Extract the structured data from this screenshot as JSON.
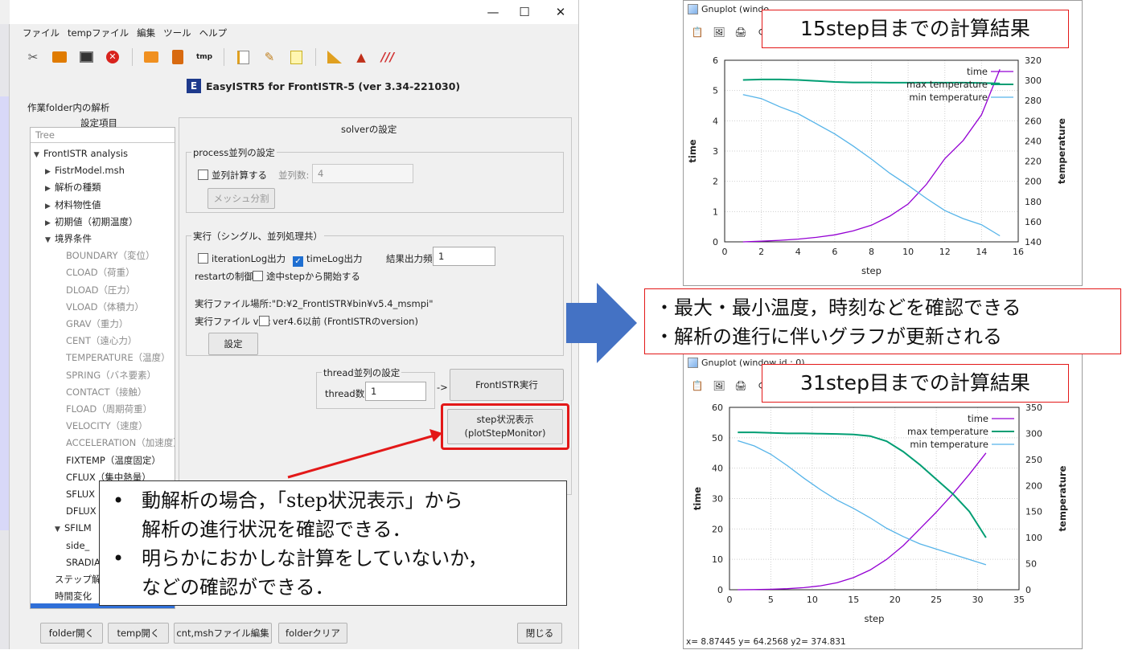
{
  "window": {
    "controls": {
      "minimize": "—",
      "maximize": "☐",
      "close": "✕"
    }
  },
  "menu": [
    "ファイル",
    "tempファイル",
    "編集",
    "ツール",
    "ヘルプ"
  ],
  "toolbar_icons": [
    "tools-icon",
    "folder-icon",
    "monitor-icon",
    "stop-icon",
    "open-folder-icon",
    "upload-icon",
    "tmp-icon",
    "edit-icon",
    "broom-icon",
    "note-icon",
    "ruler-icon",
    "shape-icon",
    "palette-icon"
  ],
  "app_title": "EasyISTR5 for FrontISTR-5  (ver 3.34-221030)",
  "app_logo": "E",
  "work_folder_label": "作業folder内の解析",
  "settings_header": "設定項目",
  "tree": {
    "header": "Tree",
    "items": [
      {
        "label": "FrontISTR analysis",
        "arrow": "▼"
      },
      {
        "label": "FistrModel.msh",
        "arrow": "▶"
      },
      {
        "label": "解析の種類",
        "arrow": "▶"
      },
      {
        "label": "材料物性値",
        "arrow": "▶"
      },
      {
        "label": "初期値（初期温度）",
        "arrow": "▶"
      },
      {
        "label": "境界条件",
        "arrow": "▼"
      },
      {
        "label": "BOUNDARY（変位）"
      },
      {
        "label": "CLOAD（荷重）"
      },
      {
        "label": "DLOAD（圧力）"
      },
      {
        "label": "VLOAD（体積力）"
      },
      {
        "label": "GRAV（重力）"
      },
      {
        "label": "CENT（遠心力）"
      },
      {
        "label": "TEMPERATURE（温度）"
      },
      {
        "label": "SPRING（バネ要素）"
      },
      {
        "label": "CONTACT（接触）"
      },
      {
        "label": "FLOAD（周期荷重）"
      },
      {
        "label": "VELOCITY（速度）"
      },
      {
        "label": "ACCELERATION（加速度）"
      },
      {
        "label": "FIXTEMP（温度固定）"
      },
      {
        "label": "CFLUX（集中熱量）"
      },
      {
        "label": "SFLUX"
      },
      {
        "label": "DFLUX"
      },
      {
        "label": "SFILM",
        "arrow": "▼"
      },
      {
        "label": "side_"
      },
      {
        "label": "SRADIA"
      },
      {
        "label": "ステップ解析"
      },
      {
        "label": "時間変化"
      }
    ]
  },
  "solver": {
    "title": "solverの設定",
    "process_group": "process並列の設定",
    "parallel_check": "並列計算する",
    "parallel_count_label": "並列数:",
    "parallel_count_value": "4",
    "mesh_split_button": "メッシュ分割",
    "exec_group": "実行（シングル、並列処理共）",
    "iteration_log": "iterationLog出力",
    "timelog": "timeLog出力",
    "output_freq_label": "結果出力頻度",
    "output_freq_value": "1",
    "restart_label": "restartの制御:",
    "restart_check": "途中stepから開始する",
    "exe_location": "実行ファイル場所:\"D:¥2_FrontISTR¥bin¥v5.4_msmpi\"",
    "exe_ver_label": "実行ファイル ver:",
    "exe_ver_check": "ver4.6以前 (FrontISTRのversion)",
    "settings_button": "設定",
    "thread_group": "thread並列の設定",
    "thread_label": "thread数:",
    "thread_value": "1",
    "arrow_text": "->",
    "run_button": "FrontISTR実行",
    "monitor_button_line1": "step状況表示",
    "monitor_button_line2": "(plotStepMonitor)"
  },
  "bottom_buttons": [
    "folder開く",
    "temp開く",
    "cnt,mshファイル編集",
    "folderクリア",
    "閉じる"
  ],
  "callout": {
    "bullet": "•",
    "lines": [
      "動解析の場合，「step状況表示」から",
      "解析の進行状況を確認できる．",
      "明らかにおかしな計算をしていないか，",
      "などの確認ができる．"
    ]
  },
  "gnuplot_top": {
    "title": "Gnuplot (windo",
    "label": "15step目までの計算結果"
  },
  "gnuplot_bottom": {
    "title": "Gnuplot (window id : 0)",
    "label": "31step目までの計算結果",
    "status": "x= 8.87445 y= 64.2568 y2= 374.831"
  },
  "note": {
    "lines": [
      "・最大・最小温度，時刻などを確認できる",
      "・解析の進行に伴いグラフが更新される"
    ]
  },
  "colors": {
    "time": "#9400d3",
    "max": "#009e73",
    "min": "#56b4e9",
    "red": "#e31818",
    "blue_arrow": "#4472c4"
  },
  "chart_data": [
    {
      "type": "line",
      "xlabel": "step",
      "ylabel": "time",
      "y2label": "temperature",
      "xlim": [
        0,
        16
      ],
      "ylim": [
        0,
        6
      ],
      "y2lim": [
        140,
        320
      ],
      "xticks": [
        0,
        2,
        4,
        6,
        8,
        10,
        12,
        14,
        16
      ],
      "yticks": [
        0,
        1,
        2,
        3,
        4,
        5,
        6
      ],
      "y2ticks": [
        140,
        160,
        180,
        200,
        220,
        240,
        260,
        280,
        300,
        320
      ],
      "grid": true,
      "legend": "top-right",
      "series": [
        {
          "name": "time",
          "axis": "y",
          "x": [
            1,
            2,
            3,
            4,
            5,
            6,
            7,
            8,
            9,
            10,
            11,
            12,
            13,
            14,
            15
          ],
          "values": [
            0.0,
            0.02,
            0.05,
            0.09,
            0.15,
            0.23,
            0.36,
            0.55,
            0.85,
            1.25,
            1.9,
            2.75,
            3.35,
            4.2,
            5.7
          ]
        },
        {
          "name": "max temperature",
          "axis": "y2",
          "x": [
            1,
            2,
            3,
            4,
            5,
            6,
            7,
            8,
            9,
            10,
            11,
            12,
            13,
            14,
            15
          ],
          "values": [
            300.5,
            301,
            301,
            300.5,
            299.5,
            298.5,
            298,
            298,
            297.8,
            297.8,
            297.8,
            297.8,
            297.8,
            297.5,
            297
          ]
        },
        {
          "name": "min temperature",
          "axis": "y2",
          "x": [
            1,
            2,
            3,
            4,
            5,
            6,
            7,
            8,
            9,
            10,
            11,
            12,
            13,
            14,
            15
          ],
          "values": [
            286,
            282,
            274,
            267,
            257,
            247,
            235,
            222,
            208,
            196,
            183,
            171,
            163,
            157,
            146
          ]
        }
      ]
    },
    {
      "type": "line",
      "xlabel": "step",
      "ylabel": "time",
      "y2label": "temperature",
      "xlim": [
        0,
        35
      ],
      "ylim": [
        0,
        60
      ],
      "y2lim": [
        0,
        350
      ],
      "xticks": [
        0,
        5,
        10,
        15,
        20,
        25,
        30,
        35
      ],
      "yticks": [
        0,
        10,
        20,
        30,
        40,
        50,
        60
      ],
      "y2ticks": [
        0,
        50,
        100,
        150,
        200,
        250,
        300,
        350
      ],
      "grid": true,
      "legend": "top-right",
      "series": [
        {
          "name": "time",
          "axis": "y",
          "x": [
            1,
            3,
            5,
            7,
            9,
            11,
            13,
            15,
            17,
            19,
            21,
            23,
            25,
            27,
            29,
            31
          ],
          "values": [
            0,
            0.05,
            0.15,
            0.35,
            0.7,
            1.3,
            2.3,
            4,
            6.5,
            10,
            14.5,
            20,
            25.5,
            31.5,
            38,
            45
          ]
        },
        {
          "name": "max temperature",
          "axis": "y2",
          "x": [
            1,
            3,
            5,
            7,
            9,
            11,
            13,
            15,
            17,
            19,
            21,
            23,
            25,
            27,
            29,
            31
          ],
          "values": [
            302,
            302,
            301,
            300,
            300,
            299.5,
            299,
            298,
            295,
            285,
            265,
            240,
            212,
            184,
            150,
            100
          ]
        },
        {
          "name": "min temperature",
          "axis": "y2",
          "x": [
            1,
            3,
            5,
            7,
            9,
            11,
            13,
            15,
            17,
            19,
            21,
            23,
            25,
            27,
            29,
            31
          ],
          "values": [
            286,
            276,
            260,
            238,
            214,
            192,
            172,
            156,
            138,
            118,
            102,
            88,
            78,
            68,
            58,
            48
          ]
        }
      ]
    }
  ]
}
